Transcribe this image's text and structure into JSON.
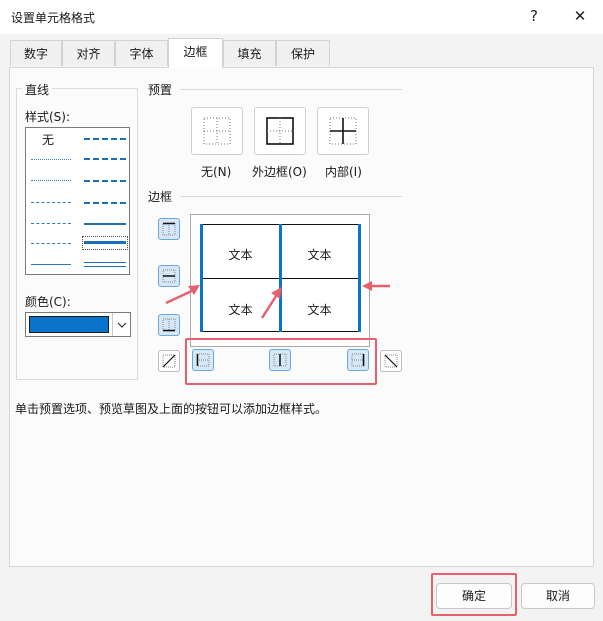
{
  "window": {
    "title": "设置单元格格式",
    "help_glyph": "?",
    "close_glyph": "✕"
  },
  "tabs": [
    {
      "label": "数字"
    },
    {
      "label": "对齐"
    },
    {
      "label": "字体"
    },
    {
      "label": "边框",
      "active": true
    },
    {
      "label": "填充"
    },
    {
      "label": "保护"
    }
  ],
  "line_group": {
    "heading": "直线",
    "style_label": "样式(S):",
    "style_none": "无",
    "color_label": "颜色(C):",
    "color_value": "#0a74cc"
  },
  "presets": {
    "heading": "预置",
    "items": [
      {
        "label": "无(N)"
      },
      {
        "label": "外边框(O)"
      },
      {
        "label": "内部(I)"
      }
    ]
  },
  "border": {
    "heading": "边框",
    "preview_text": [
      "文本",
      "文本",
      "文本",
      "文本"
    ]
  },
  "hint": "单击预置选项、预览草图及上面的按钮可以添加边框样式。",
  "footer": {
    "ok_label": "确定",
    "cancel_label": "取消"
  },
  "colors": {
    "accent": "#0a74cc",
    "highlight": "#e8606e"
  }
}
